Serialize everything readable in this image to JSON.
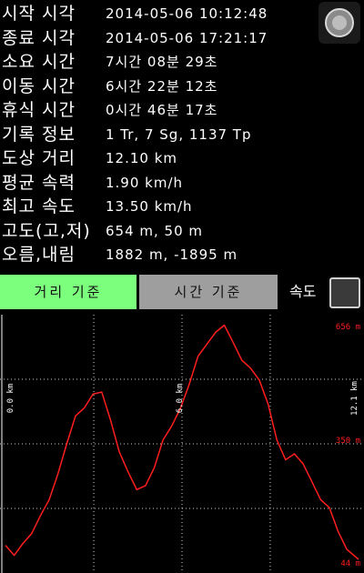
{
  "stats": [
    {
      "label": "시작 시각",
      "value": "2014-05-06 10:12:48"
    },
    {
      "label": "종료 시각",
      "value": "2014-05-06 17:21:17"
    },
    {
      "label": "소요 시간",
      "value": "7시간 08분 29초"
    },
    {
      "label": "이동 시간",
      "value": "6시간 22분 12초"
    },
    {
      "label": "휴식 시간",
      "value": "0시간 46분 17초"
    },
    {
      "label": "기록 정보",
      "value": "1 Tr, 7 Sg, 1137 Tp"
    },
    {
      "label": "도상 거리",
      "value": "12.10 km"
    },
    {
      "label": "평균 속력",
      "value": "1.90 km/h"
    },
    {
      "label": "최고 속도",
      "value": "13.50 km/h"
    },
    {
      "label": "고도(고,저)",
      "value": "654 m, 50 m"
    },
    {
      "label": "오름,내림",
      "value": "1882 m, -1895 m"
    }
  ],
  "tabs": {
    "distance": "거리 기준",
    "time": "시간 기준",
    "selected": "distance"
  },
  "speed_toggle": {
    "label": "속도",
    "checked": false
  },
  "colors": {
    "accent_green": "#7cff7c",
    "tab_gray": "#9e9e9e",
    "line_red": "#ff1e1e",
    "grid": "#ffffff"
  },
  "chart_data": {
    "type": "line",
    "x_tick_labels": [
      "0.0 km",
      "6.0 km",
      "12.1 km"
    ],
    "y_tick_labels": [
      "656 m",
      "350 m",
      "44 m"
    ],
    "xlim": [
      0,
      12.1
    ],
    "ylim": [
      44,
      656
    ],
    "grid": true,
    "series": [
      {
        "x": [
          0.0,
          0.3,
          0.6,
          0.9,
          1.2,
          1.5,
          1.8,
          2.1,
          2.4,
          2.7,
          3.0,
          3.3,
          3.6,
          3.9,
          4.2,
          4.5,
          4.8,
          5.1,
          5.4,
          5.7,
          6.0,
          6.3,
          6.6,
          6.9,
          7.2,
          7.5,
          7.8,
          8.1,
          8.4,
          8.7,
          9.0,
          9.3,
          9.6,
          9.9,
          10.2,
          10.5,
          10.8,
          11.1,
          11.4,
          11.7,
          12.1
        ],
        "y": [
          95,
          70,
          100,
          125,
          170,
          210,
          275,
          350,
          420,
          440,
          475,
          480,
          410,
          330,
          280,
          235,
          245,
          290,
          360,
          395,
          440,
          500,
          570,
          600,
          630,
          648,
          605,
          560,
          540,
          510,
          450,
          360,
          310,
          325,
          300,
          255,
          210,
          190,
          130,
          85,
          60
        ]
      }
    ]
  }
}
